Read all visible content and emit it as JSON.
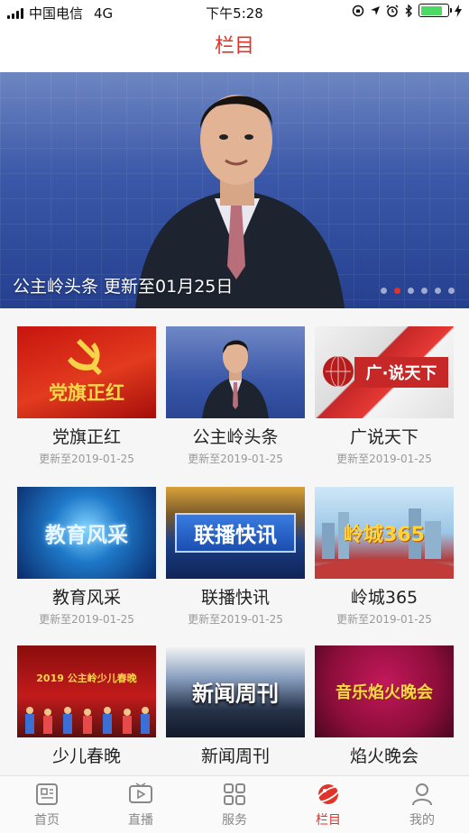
{
  "status": {
    "carrier": "中国电信",
    "network": "4G",
    "time": "下午5:28",
    "battery_color": "#4cd964"
  },
  "nav": {
    "title": "栏目"
  },
  "banner": {
    "caption": "公主岭头条  更新至01月25日",
    "dot_count": 6,
    "active_dot": 1
  },
  "programs": [
    {
      "title": "党旗正红",
      "date": "更新至2019-01-25",
      "thumb_text": "党旗正红"
    },
    {
      "title": "公主岭头条",
      "date": "更新至2019-01-25",
      "thumb_text": ""
    },
    {
      "title": "广说天下",
      "date": "更新至2019-01-25",
      "thumb_text": "广·说天下"
    },
    {
      "title": "教育风采",
      "date": "更新至2019-01-25",
      "thumb_text": "教育风采"
    },
    {
      "title": "联播快讯",
      "date": "更新至2019-01-25",
      "thumb_text": "联播快讯"
    },
    {
      "title": "岭城365",
      "date": "更新至2019-01-25",
      "thumb_text": "岭城365"
    },
    {
      "title": "少儿春晚",
      "date": "",
      "thumb_text": "2019 公主岭少儿春晚"
    },
    {
      "title": "新闻周刊",
      "date": "",
      "thumb_text": "新闻周刊"
    },
    {
      "title": "焰火晚会",
      "date": "",
      "thumb_text": "音乐焰火晚会"
    }
  ],
  "tabs": [
    {
      "label": "首页",
      "icon": "news-icon"
    },
    {
      "label": "直播",
      "icon": "live-tv-icon"
    },
    {
      "label": "服务",
      "icon": "grid-icon"
    },
    {
      "label": "栏目",
      "icon": "column-planet-icon"
    },
    {
      "label": "我的",
      "icon": "user-icon"
    }
  ],
  "colors": {
    "accent": "#e0342a"
  }
}
